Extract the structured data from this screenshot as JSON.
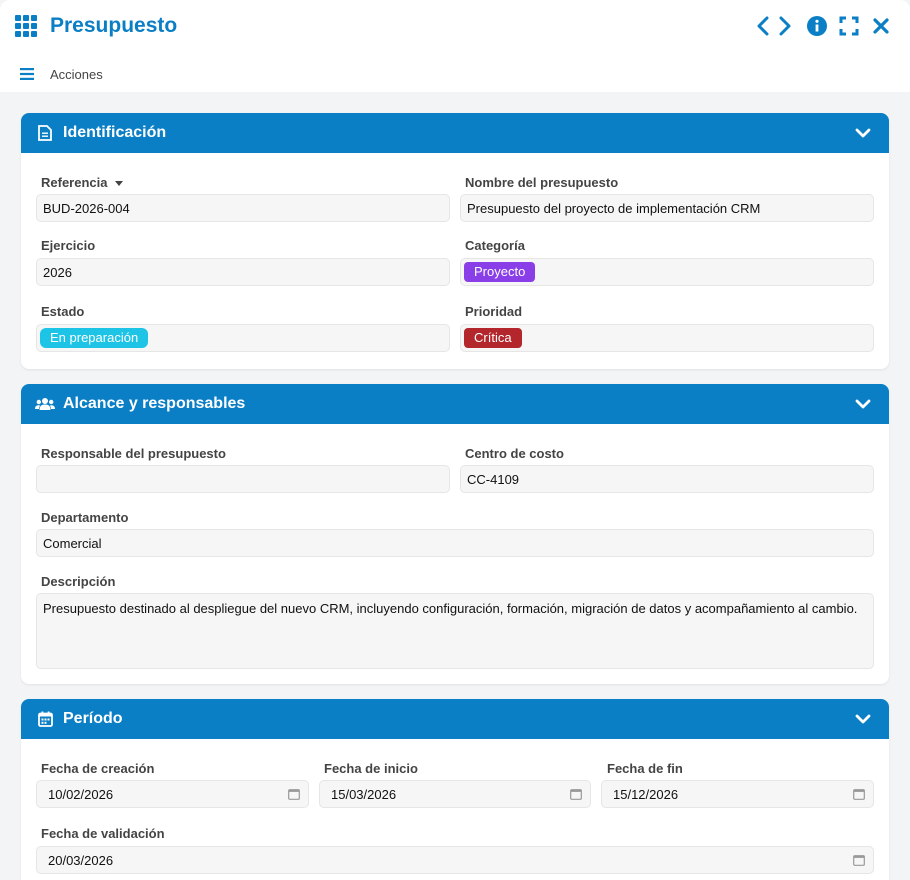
{
  "window": {
    "title": "Presupuesto",
    "actions_label": "Acciones"
  },
  "colors": {
    "accent": "#0a7fc6",
    "chip_proyecto": "#8a3ee8",
    "chip_estado": "#1ec4e6",
    "chip_critica": "#b3262b"
  },
  "sections": {
    "identificacion": {
      "title": "Identificación",
      "referencia_label": "Referencia",
      "referencia_value": "BUD-2026-004",
      "nombre_label": "Nombre del presupuesto",
      "nombre_value": "Presupuesto del proyecto de implementación CRM",
      "ejercicio_label": "Ejercicio",
      "ejercicio_value": "2026",
      "categoria_label": "Categoría",
      "categoria_value": "Proyecto",
      "estado_label": "Estado",
      "estado_value": "En preparación",
      "prioridad_label": "Prioridad",
      "prioridad_value": "Crítica"
    },
    "alcance": {
      "title": "Alcance y responsables",
      "responsable_label": "Responsable del presupuesto",
      "responsable_value": "",
      "centro_label": "Centro de costo",
      "centro_value": "CC-4109",
      "departamento_label": "Departamento",
      "departamento_value": "Comercial",
      "descripcion_label": "Descripción",
      "descripcion_value": "Presupuesto destinado al despliegue del nuevo CRM, incluyendo configuración, formación, migración de datos y acompañamiento al cambio."
    },
    "periodo": {
      "title": "Período",
      "creacion_label": "Fecha de creación",
      "creacion_value": "10/02/2026",
      "inicio_label": "Fecha de inicio",
      "inicio_value": "15/03/2026",
      "fin_label": "Fecha de fin",
      "fin_value": "15/12/2026",
      "validacion_label": "Fecha de validación",
      "validacion_value": "20/03/2026"
    }
  }
}
